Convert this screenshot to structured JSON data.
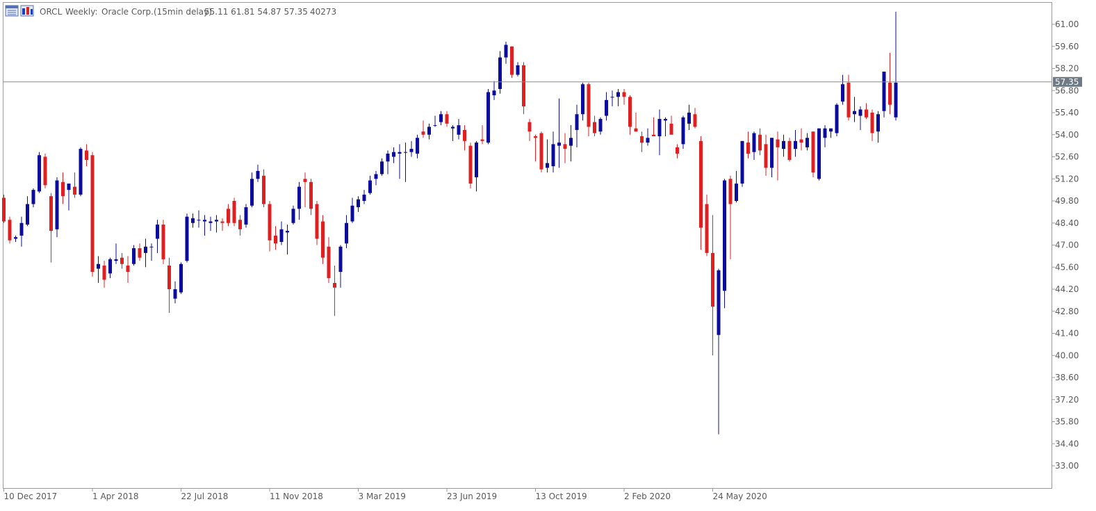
{
  "header": {
    "symbol": "ORCL",
    "timeframe": "Weekly:",
    "description": "Oracle Corp.(15min delay)",
    "ohlc_text": "55.11 61.81 54.87 57.35",
    "volume": "40273"
  },
  "icons": [
    "properties-icon",
    "chart-type-icon"
  ],
  "colors": {
    "bull": "#0c0c9c",
    "bear": "#e02020",
    "grid_border": "#9a9a9a",
    "price_line": "#8a8a8a",
    "price_tag_bg": "#6e7b86"
  },
  "current_price_label": "57.35",
  "chart_data": {
    "type": "candlestick",
    "ylim": [
      32.0,
      62.2
    ],
    "y_ticks": [
      "61.00",
      "59.60",
      "58.20",
      "56.80",
      "55.40",
      "54.00",
      "52.60",
      "51.20",
      "49.80",
      "48.40",
      "47.00",
      "45.60",
      "44.20",
      "42.80",
      "41.40",
      "40.00",
      "38.60",
      "37.20",
      "35.80",
      "34.40",
      "33.00"
    ],
    "x_ticks": [
      "10 Dec 2017",
      "1 Apr 2018",
      "22 Jul 2018",
      "11 Nov 2018",
      "3 Mar 2019",
      "23 Jun 2019",
      "13 Oct 2019",
      "2 Feb 2020",
      "24 May 2020"
    ],
    "current_price": 57.35,
    "grid": false,
    "candles": [
      {
        "o": 50.0,
        "h": 50.2,
        "l": 48.4,
        "c": 48.5
      },
      {
        "o": 48.6,
        "h": 48.8,
        "l": 47.1,
        "c": 47.3
      },
      {
        "o": 47.4,
        "h": 47.6,
        "l": 47.2,
        "c": 47.5
      },
      {
        "o": 47.6,
        "h": 48.8,
        "l": 46.9,
        "c": 48.4
      },
      {
        "o": 48.3,
        "h": 50.1,
        "l": 48.2,
        "c": 49.6
      },
      {
        "o": 49.6,
        "h": 50.6,
        "l": 49.4,
        "c": 50.5
      },
      {
        "o": 50.4,
        "h": 52.9,
        "l": 50.3,
        "c": 52.7
      },
      {
        "o": 52.6,
        "h": 52.8,
        "l": 50.6,
        "c": 50.8
      },
      {
        "o": 50.1,
        "h": 50.3,
        "l": 45.9,
        "c": 47.9
      },
      {
        "o": 48.0,
        "h": 51.3,
        "l": 47.5,
        "c": 51.1
      },
      {
        "o": 51.0,
        "h": 51.6,
        "l": 49.6,
        "c": 50.1
      },
      {
        "o": 50.5,
        "h": 50.9,
        "l": 49.2,
        "c": 50.9
      },
      {
        "o": 50.7,
        "h": 51.6,
        "l": 50.0,
        "c": 50.2
      },
      {
        "o": 50.2,
        "h": 53.2,
        "l": 50.1,
        "c": 53.1
      },
      {
        "o": 53.0,
        "h": 53.4,
        "l": 52.0,
        "c": 52.4
      },
      {
        "o": 52.7,
        "h": 52.9,
        "l": 45.0,
        "c": 45.3
      },
      {
        "o": 45.5,
        "h": 46.3,
        "l": 44.6,
        "c": 45.8
      },
      {
        "o": 45.7,
        "h": 46.0,
        "l": 44.3,
        "c": 44.8
      },
      {
        "o": 45.2,
        "h": 46.2,
        "l": 44.9,
        "c": 46.1
      },
      {
        "o": 46.0,
        "h": 47.1,
        "l": 45.8,
        "c": 46.1
      },
      {
        "o": 46.2,
        "h": 46.5,
        "l": 45.5,
        "c": 45.8
      },
      {
        "o": 45.7,
        "h": 46.3,
        "l": 44.6,
        "c": 45.3
      },
      {
        "o": 45.8,
        "h": 47.0,
        "l": 45.7,
        "c": 46.8
      },
      {
        "o": 46.8,
        "h": 47.1,
        "l": 46.0,
        "c": 46.2
      },
      {
        "o": 46.5,
        "h": 47.4,
        "l": 45.6,
        "c": 46.9
      },
      {
        "o": 46.9,
        "h": 47.1,
        "l": 46.0,
        "c": 46.9
      },
      {
        "o": 47.4,
        "h": 48.6,
        "l": 46.5,
        "c": 48.3
      },
      {
        "o": 48.3,
        "h": 48.6,
        "l": 45.8,
        "c": 46.1
      },
      {
        "o": 45.7,
        "h": 46.2,
        "l": 42.7,
        "c": 44.2
      },
      {
        "o": 43.6,
        "h": 44.7,
        "l": 43.3,
        "c": 44.2
      },
      {
        "o": 44.0,
        "h": 45.9,
        "l": 43.9,
        "c": 45.8
      },
      {
        "o": 46.0,
        "h": 49.0,
        "l": 45.9,
        "c": 48.8
      },
      {
        "o": 48.4,
        "h": 49.0,
        "l": 48.1,
        "c": 48.7
      },
      {
        "o": 48.6,
        "h": 49.2,
        "l": 48.1,
        "c": 48.6
      },
      {
        "o": 48.5,
        "h": 48.9,
        "l": 47.6,
        "c": 48.6
      },
      {
        "o": 48.4,
        "h": 48.8,
        "l": 47.9,
        "c": 48.5
      },
      {
        "o": 48.5,
        "h": 48.9,
        "l": 47.8,
        "c": 48.6
      },
      {
        "o": 48.5,
        "h": 48.7,
        "l": 47.9,
        "c": 48.4
      },
      {
        "o": 49.3,
        "h": 49.6,
        "l": 48.2,
        "c": 48.4
      },
      {
        "o": 49.8,
        "h": 50.0,
        "l": 48.2,
        "c": 48.4
      },
      {
        "o": 48.6,
        "h": 48.9,
        "l": 47.6,
        "c": 48.0
      },
      {
        "o": 48.3,
        "h": 49.6,
        "l": 48.1,
        "c": 49.4
      },
      {
        "o": 49.5,
        "h": 51.6,
        "l": 49.4,
        "c": 51.2
      },
      {
        "o": 51.2,
        "h": 52.1,
        "l": 51.0,
        "c": 51.7
      },
      {
        "o": 51.4,
        "h": 51.8,
        "l": 49.4,
        "c": 49.6
      },
      {
        "o": 49.6,
        "h": 49.8,
        "l": 46.6,
        "c": 47.3
      },
      {
        "o": 47.6,
        "h": 48.2,
        "l": 46.7,
        "c": 47.1
      },
      {
        "o": 47.2,
        "h": 48.5,
        "l": 47.0,
        "c": 48.0
      },
      {
        "o": 47.8,
        "h": 48.3,
        "l": 46.4,
        "c": 47.9
      },
      {
        "o": 48.4,
        "h": 49.5,
        "l": 48.3,
        "c": 49.3
      },
      {
        "o": 49.3,
        "h": 51.0,
        "l": 48.6,
        "c": 50.7
      },
      {
        "o": 51.2,
        "h": 51.6,
        "l": 49.4,
        "c": 51.0
      },
      {
        "o": 51.0,
        "h": 51.2,
        "l": 48.9,
        "c": 49.3
      },
      {
        "o": 49.6,
        "h": 49.8,
        "l": 47.0,
        "c": 47.4
      },
      {
        "o": 48.5,
        "h": 48.9,
        "l": 45.8,
        "c": 46.2
      },
      {
        "o": 46.9,
        "h": 47.5,
        "l": 44.6,
        "c": 44.9
      },
      {
        "o": 44.6,
        "h": 45.7,
        "l": 42.5,
        "c": 44.3
      },
      {
        "o": 45.3,
        "h": 47.0,
        "l": 44.3,
        "c": 46.9
      },
      {
        "o": 47.1,
        "h": 48.9,
        "l": 46.8,
        "c": 48.4
      },
      {
        "o": 48.5,
        "h": 50.0,
        "l": 48.4,
        "c": 49.5
      },
      {
        "o": 49.4,
        "h": 50.1,
        "l": 49.1,
        "c": 49.9
      },
      {
        "o": 49.8,
        "h": 50.5,
        "l": 49.6,
        "c": 50.2
      },
      {
        "o": 50.3,
        "h": 51.4,
        "l": 50.2,
        "c": 51.1
      },
      {
        "o": 51.2,
        "h": 51.7,
        "l": 50.8,
        "c": 51.5
      },
      {
        "o": 51.5,
        "h": 52.5,
        "l": 51.4,
        "c": 52.3
      },
      {
        "o": 52.3,
        "h": 53.0,
        "l": 51.5,
        "c": 52.8
      },
      {
        "o": 52.6,
        "h": 53.2,
        "l": 52.2,
        "c": 52.9
      },
      {
        "o": 52.8,
        "h": 53.4,
        "l": 51.2,
        "c": 52.9
      },
      {
        "o": 52.9,
        "h": 53.5,
        "l": 51.0,
        "c": 52.9
      },
      {
        "o": 52.9,
        "h": 53.6,
        "l": 52.6,
        "c": 53.1
      },
      {
        "o": 52.8,
        "h": 54.0,
        "l": 52.5,
        "c": 53.8
      },
      {
        "o": 54.2,
        "h": 54.9,
        "l": 53.8,
        "c": 54.0
      },
      {
        "o": 54.0,
        "h": 54.7,
        "l": 53.7,
        "c": 54.5
      },
      {
        "o": 54.6,
        "h": 55.2,
        "l": 54.5,
        "c": 54.6
      },
      {
        "o": 54.8,
        "h": 55.5,
        "l": 54.6,
        "c": 55.3
      },
      {
        "o": 55.3,
        "h": 55.5,
        "l": 54.5,
        "c": 54.7
      },
      {
        "o": 54.4,
        "h": 54.6,
        "l": 53.6,
        "c": 54.5
      },
      {
        "o": 54.0,
        "h": 55.0,
        "l": 53.7,
        "c": 54.6
      },
      {
        "o": 54.3,
        "h": 54.6,
        "l": 53.0,
        "c": 53.6
      },
      {
        "o": 53.3,
        "h": 53.5,
        "l": 50.6,
        "c": 50.9
      },
      {
        "o": 51.3,
        "h": 53.6,
        "l": 50.4,
        "c": 53.5
      },
      {
        "o": 53.7,
        "h": 54.6,
        "l": 53.4,
        "c": 53.6
      },
      {
        "o": 53.5,
        "h": 56.9,
        "l": 53.4,
        "c": 56.7
      },
      {
        "o": 56.5,
        "h": 57.4,
        "l": 56.2,
        "c": 56.8
      },
      {
        "o": 56.9,
        "h": 59.3,
        "l": 56.6,
        "c": 58.9
      },
      {
        "o": 58.9,
        "h": 59.9,
        "l": 58.5,
        "c": 59.7
      },
      {
        "o": 59.6,
        "h": 59.6,
        "l": 57.6,
        "c": 57.8
      },
      {
        "o": 57.8,
        "h": 58.6,
        "l": 57.7,
        "c": 58.4
      },
      {
        "o": 58.4,
        "h": 58.6,
        "l": 55.3,
        "c": 55.8
      },
      {
        "o": 54.8,
        "h": 55.0,
        "l": 53.6,
        "c": 54.2
      },
      {
        "o": 53.9,
        "h": 54.0,
        "l": 52.3,
        "c": 53.8
      },
      {
        "o": 54.1,
        "h": 54.2,
        "l": 51.6,
        "c": 51.8
      },
      {
        "o": 51.9,
        "h": 53.7,
        "l": 51.6,
        "c": 52.2
      },
      {
        "o": 52.0,
        "h": 54.2,
        "l": 51.6,
        "c": 53.4
      },
      {
        "o": 53.3,
        "h": 56.3,
        "l": 51.9,
        "c": 53.5
      },
      {
        "o": 53.4,
        "h": 54.1,
        "l": 52.2,
        "c": 53.1
      },
      {
        "o": 53.3,
        "h": 54.6,
        "l": 52.3,
        "c": 53.8
      },
      {
        "o": 54.3,
        "h": 55.9,
        "l": 53.2,
        "c": 55.3
      },
      {
        "o": 55.3,
        "h": 57.3,
        "l": 54.9,
        "c": 57.2
      },
      {
        "o": 57.2,
        "h": 57.3,
        "l": 53.9,
        "c": 54.5
      },
      {
        "o": 54.8,
        "h": 55.2,
        "l": 53.9,
        "c": 54.1
      },
      {
        "o": 54.2,
        "h": 55.1,
        "l": 54.0,
        "c": 55.0
      },
      {
        "o": 55.2,
        "h": 56.7,
        "l": 54.9,
        "c": 56.2
      },
      {
        "o": 56.4,
        "h": 56.8,
        "l": 55.8,
        "c": 56.4
      },
      {
        "o": 56.4,
        "h": 56.9,
        "l": 55.8,
        "c": 56.7
      },
      {
        "o": 56.7,
        "h": 56.9,
        "l": 55.9,
        "c": 56.4
      },
      {
        "o": 56.4,
        "h": 56.5,
        "l": 54.0,
        "c": 54.5
      },
      {
        "o": 54.4,
        "h": 55.4,
        "l": 54.2,
        "c": 54.2
      },
      {
        "o": 53.9,
        "h": 54.2,
        "l": 52.9,
        "c": 53.5
      },
      {
        "o": 53.5,
        "h": 54.4,
        "l": 53.3,
        "c": 53.8
      },
      {
        "o": 54.0,
        "h": 55.1,
        "l": 53.9,
        "c": 53.9
      },
      {
        "o": 53.9,
        "h": 55.6,
        "l": 52.7,
        "c": 55.0
      },
      {
        "o": 54.9,
        "h": 55.1,
        "l": 53.9,
        "c": 55.0
      },
      {
        "o": 54.7,
        "h": 55.2,
        "l": 54.2,
        "c": 54.0
      },
      {
        "o": 53.2,
        "h": 53.4,
        "l": 52.5,
        "c": 52.8
      },
      {
        "o": 53.4,
        "h": 55.2,
        "l": 53.1,
        "c": 55.1
      },
      {
        "o": 54.7,
        "h": 55.9,
        "l": 54.3,
        "c": 55.4
      },
      {
        "o": 55.3,
        "h": 55.7,
        "l": 54.4,
        "c": 54.5
      },
      {
        "o": 53.6,
        "h": 53.9,
        "l": 46.7,
        "c": 48.1
      },
      {
        "o": 49.6,
        "h": 50.2,
        "l": 46.3,
        "c": 46.5
      },
      {
        "o": 46.5,
        "h": 48.9,
        "l": 40.0,
        "c": 43.1
      },
      {
        "o": 41.3,
        "h": 45.5,
        "l": 35.0,
        "c": 45.4
      },
      {
        "o": 44.1,
        "h": 51.2,
        "l": 43.0,
        "c": 51.1
      },
      {
        "o": 51.2,
        "h": 51.4,
        "l": 46.1,
        "c": 49.6
      },
      {
        "o": 49.8,
        "h": 51.7,
        "l": 49.7,
        "c": 50.9
      },
      {
        "o": 50.9,
        "h": 53.6,
        "l": 50.7,
        "c": 53.6
      },
      {
        "o": 53.5,
        "h": 54.2,
        "l": 52.5,
        "c": 52.8
      },
      {
        "o": 52.9,
        "h": 54.2,
        "l": 52.4,
        "c": 54.1
      },
      {
        "o": 54.0,
        "h": 54.4,
        "l": 52.7,
        "c": 53.0
      },
      {
        "o": 53.4,
        "h": 54.0,
        "l": 51.4,
        "c": 51.9
      },
      {
        "o": 51.9,
        "h": 53.8,
        "l": 51.3,
        "c": 53.8
      },
      {
        "o": 53.7,
        "h": 54.2,
        "l": 51.1,
        "c": 53.2
      },
      {
        "o": 53.1,
        "h": 54.0,
        "l": 52.6,
        "c": 53.6
      },
      {
        "o": 53.6,
        "h": 53.8,
        "l": 52.3,
        "c": 52.4
      },
      {
        "o": 53.1,
        "h": 54.3,
        "l": 52.6,
        "c": 53.6
      },
      {
        "o": 53.7,
        "h": 54.4,
        "l": 53.0,
        "c": 53.5
      },
      {
        "o": 53.2,
        "h": 54.1,
        "l": 53.0,
        "c": 53.8
      },
      {
        "o": 54.2,
        "h": 54.2,
        "l": 51.3,
        "c": 51.6
      },
      {
        "o": 51.2,
        "h": 54.4,
        "l": 51.1,
        "c": 54.4
      },
      {
        "o": 53.8,
        "h": 54.6,
        "l": 53.2,
        "c": 54.4
      },
      {
        "o": 54.2,
        "h": 54.3,
        "l": 53.8,
        "c": 54.4
      },
      {
        "o": 54.1,
        "h": 56.0,
        "l": 53.9,
        "c": 55.9
      },
      {
        "o": 56.1,
        "h": 57.8,
        "l": 55.9,
        "c": 57.2
      },
      {
        "o": 57.3,
        "h": 57.8,
        "l": 54.9,
        "c": 55.1
      },
      {
        "o": 55.3,
        "h": 56.4,
        "l": 54.8,
        "c": 55.5
      },
      {
        "o": 55.2,
        "h": 55.8,
        "l": 54.3,
        "c": 55.6
      },
      {
        "o": 55.6,
        "h": 56.0,
        "l": 55.0,
        "c": 55.1
      },
      {
        "o": 55.4,
        "h": 55.6,
        "l": 53.6,
        "c": 54.1
      },
      {
        "o": 54.2,
        "h": 55.5,
        "l": 53.5,
        "c": 55.3
      },
      {
        "o": 55.5,
        "h": 57.9,
        "l": 55.1,
        "c": 58.0
      },
      {
        "o": 57.3,
        "h": 59.2,
        "l": 55.3,
        "c": 55.9
      },
      {
        "o": 55.1,
        "h": 61.8,
        "l": 54.9,
        "c": 57.3
      }
    ]
  }
}
